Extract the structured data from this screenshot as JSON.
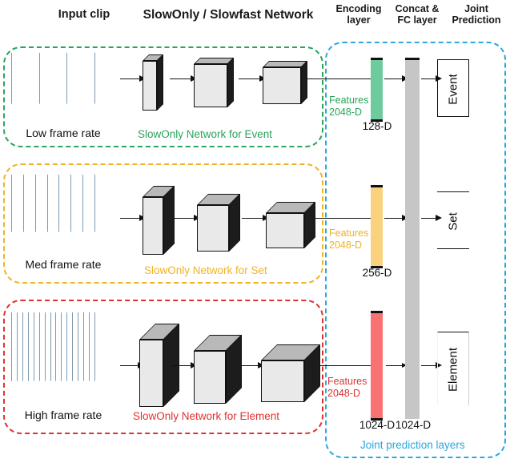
{
  "headers": {
    "input_clip": "Input clip",
    "network": "SlowOnly / Slowfast Network",
    "encoding": "Encoding\nlayer",
    "encoding_l1": "Encoding",
    "encoding_l2": "layer",
    "concat_l1": "Concat &",
    "concat_l2": "FC layer",
    "joint_l1": "Joint",
    "joint_l2": "Prediction"
  },
  "colors": {
    "event": "#2aa35c",
    "set": "#f0b323",
    "element": "#e03131",
    "joint": "#29a7e0",
    "bar_event": "#6ecb9e",
    "bar_set": "#fad27e",
    "bar_element": "#f97272",
    "bar_concat": "#c6c6c6",
    "block_face": "#e9e9e9",
    "block_side": "#1c1c1c",
    "block_top": "#b9b9b9",
    "frame": "#7d9ab0"
  },
  "branches": [
    {
      "id": "event",
      "rate_label": "Low frame rate",
      "network_caption": "SlowOnly Network for Event",
      "features_line1": "Features",
      "features_line2": "2048-D",
      "encoding_dim": "128-D",
      "prediction": "Event",
      "frame_count": 4,
      "block_depth": "thin"
    },
    {
      "id": "set",
      "rate_label": "Med frame rate",
      "network_caption": "SlowOnly Network for Set",
      "features_line1": "Features",
      "features_line2": "2048-D",
      "encoding_dim": "256-D",
      "prediction": "Set",
      "frame_count": 8,
      "block_depth": "medium"
    },
    {
      "id": "element",
      "rate_label": "High frame rate",
      "network_caption": "SlowOnly Network for Element",
      "features_line1": "Features",
      "features_line2": "2048-D",
      "encoding_dim": "1024-D",
      "prediction": "Element",
      "frame_count": 16,
      "block_depth": "deep"
    }
  ],
  "concat": {
    "dim_label": "1024-D",
    "caption": "Joint prediction layers"
  }
}
